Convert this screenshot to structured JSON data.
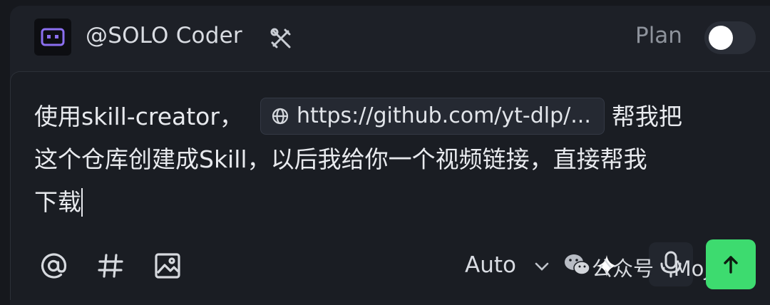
{
  "header": {
    "agent_name": "@SOLO Coder",
    "plan_label": "Plan",
    "plan_enabled": false
  },
  "prompt": {
    "line1_before": "使用skill-creator，",
    "link_chip": "https://github.com/yt-dlp/...",
    "line1_after": "帮我把",
    "line2": "这个仓库创建成Skill，以后我给你一个视频链接，直接帮我",
    "line3": "下载"
  },
  "toolbar": {
    "model_label": "Auto",
    "watermark": "公众号 · MojoAI"
  },
  "icons": {
    "agent": "robot-icon",
    "tools": "tools-icon",
    "link": "globe-icon",
    "mention": "at-icon",
    "hash": "hash-icon",
    "image": "image-icon",
    "dropdown": "chevron-down-icon",
    "wechat": "wechat-icon",
    "sparkle": "sparkle-icon",
    "mic": "microphone-icon",
    "send": "arrow-up-icon"
  },
  "colors": {
    "send_button": "#3ddb6f",
    "agent_accent": "#8b6ff0",
    "background": "#16181d"
  }
}
